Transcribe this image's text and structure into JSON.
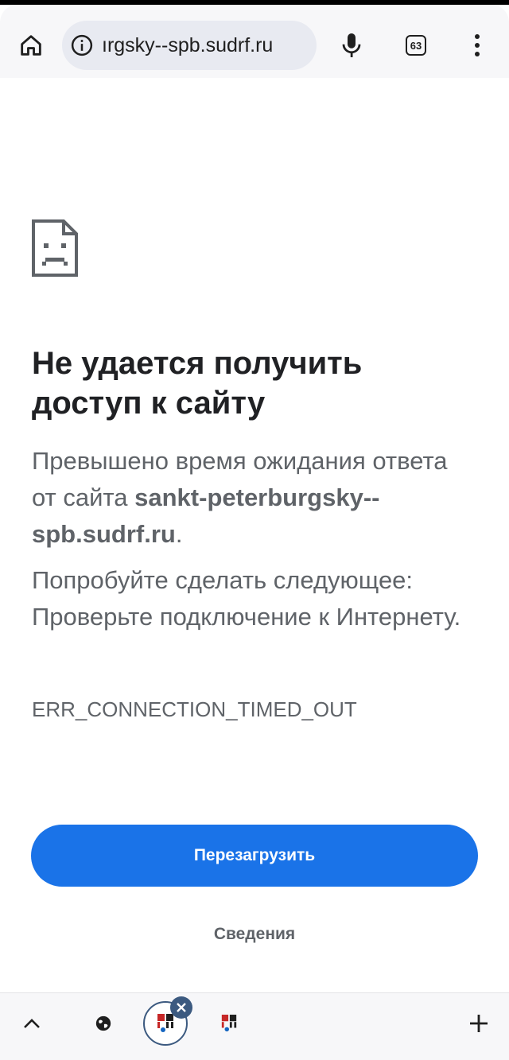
{
  "toolbar": {
    "url": "ırgsky--spb.sudrf.ru",
    "tab_count": "63"
  },
  "error": {
    "title": "Не удается получить доступ к сайту",
    "desc_prefix": "Превышено время ожидания ответа от сайта ",
    "site": "sankt-peterburgsky--spb.sudrf.ru",
    "desc_suffix": ".",
    "suggestion": "Попробуйте сделать следующее: Проверьте подключение к Интернету.",
    "code": "ERR_CONNECTION_TIMED_OUT"
  },
  "actions": {
    "reload_label": "Перезагрузить",
    "details_label": "Сведения"
  },
  "colors": {
    "accent": "#1a73e8",
    "text_primary": "#202124",
    "text_secondary": "#5f6368"
  },
  "icons": {
    "home": "home-icon",
    "info": "info-icon",
    "mic": "mic-icon",
    "menu": "more-vert-icon",
    "sad_page": "sad-page-icon",
    "chevron": "chevron-up-icon",
    "globe": "globe-icon",
    "close": "close-icon",
    "plus": "plus-icon"
  }
}
